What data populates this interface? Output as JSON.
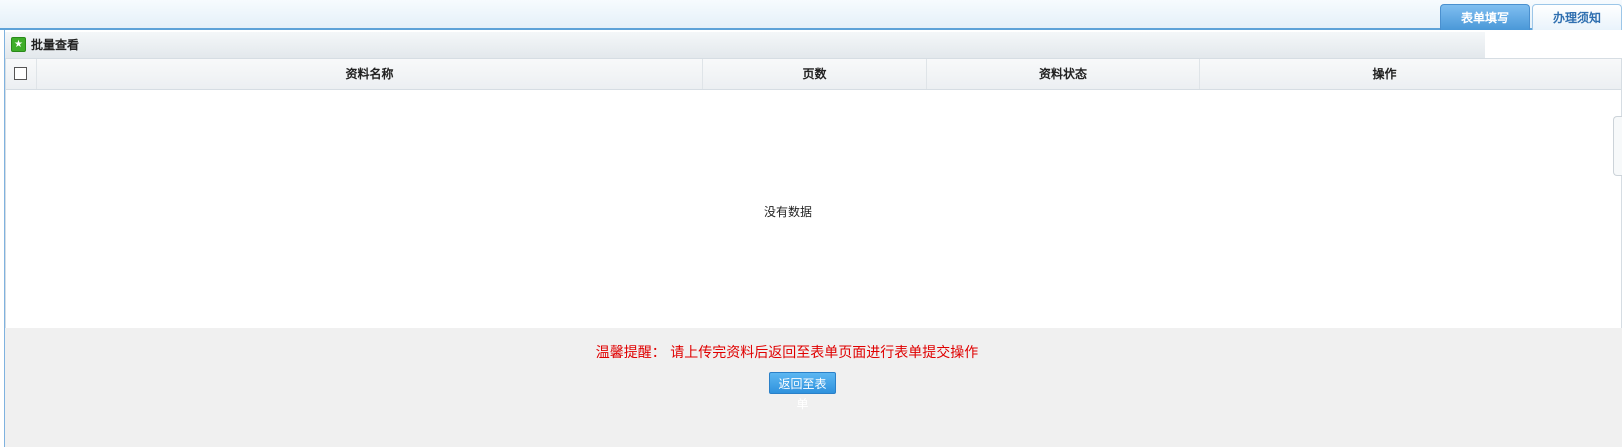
{
  "tabs": [
    {
      "label": "表单填写",
      "active": true
    },
    {
      "label": "办理须知",
      "active": false
    }
  ],
  "panel": {
    "icon": "green-star-icon",
    "title": "批量查看"
  },
  "table": {
    "columns": [
      "资料名称",
      "页数",
      "资料状态",
      "操作"
    ],
    "empty_text": "没有数据"
  },
  "footer": {
    "notice": "温馨提醒：  请上传完资料后返回至表单页面进行表单提交操作",
    "back_button": "返回至表单"
  },
  "colors": {
    "accent": "#4a98d8",
    "notice": "#e00000",
    "footer_bg": "#f0f0f0"
  }
}
